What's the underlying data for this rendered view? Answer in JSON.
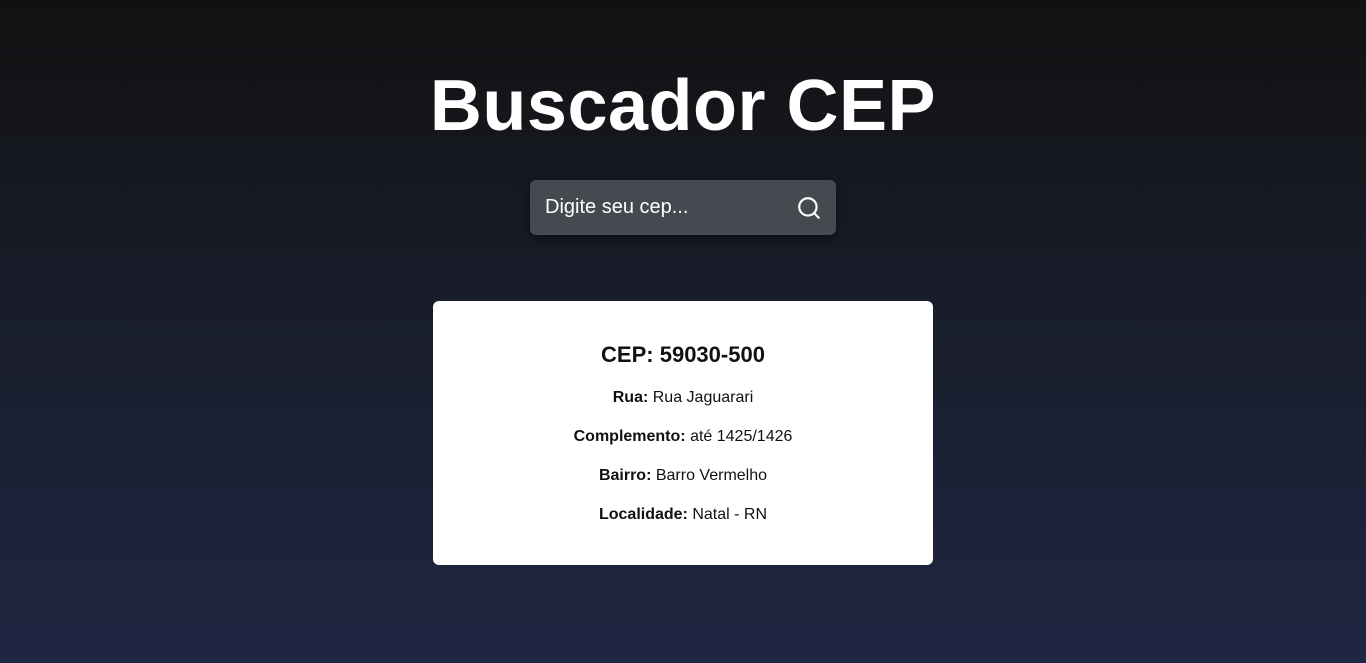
{
  "header": {
    "title": "Buscador CEP"
  },
  "search": {
    "placeholder": "Digite seu cep...",
    "value": "",
    "button_icon": "search-icon"
  },
  "result": {
    "cep_label": "CEP: 59030-500",
    "fields": [
      {
        "label": "Rua:",
        "value": "Rua Jaguarari"
      },
      {
        "label": "Complemento:",
        "value": "até 1425/1426"
      },
      {
        "label": "Bairro:",
        "value": "Barro Vermelho"
      },
      {
        "label": "Localidade:",
        "value": "Natal - RN"
      }
    ]
  },
  "colors": {
    "background_top": "#111111",
    "background_bottom": "#1f2642",
    "search_bg": "#454950",
    "card_bg": "#ffffff",
    "text_light": "#ffffff"
  }
}
